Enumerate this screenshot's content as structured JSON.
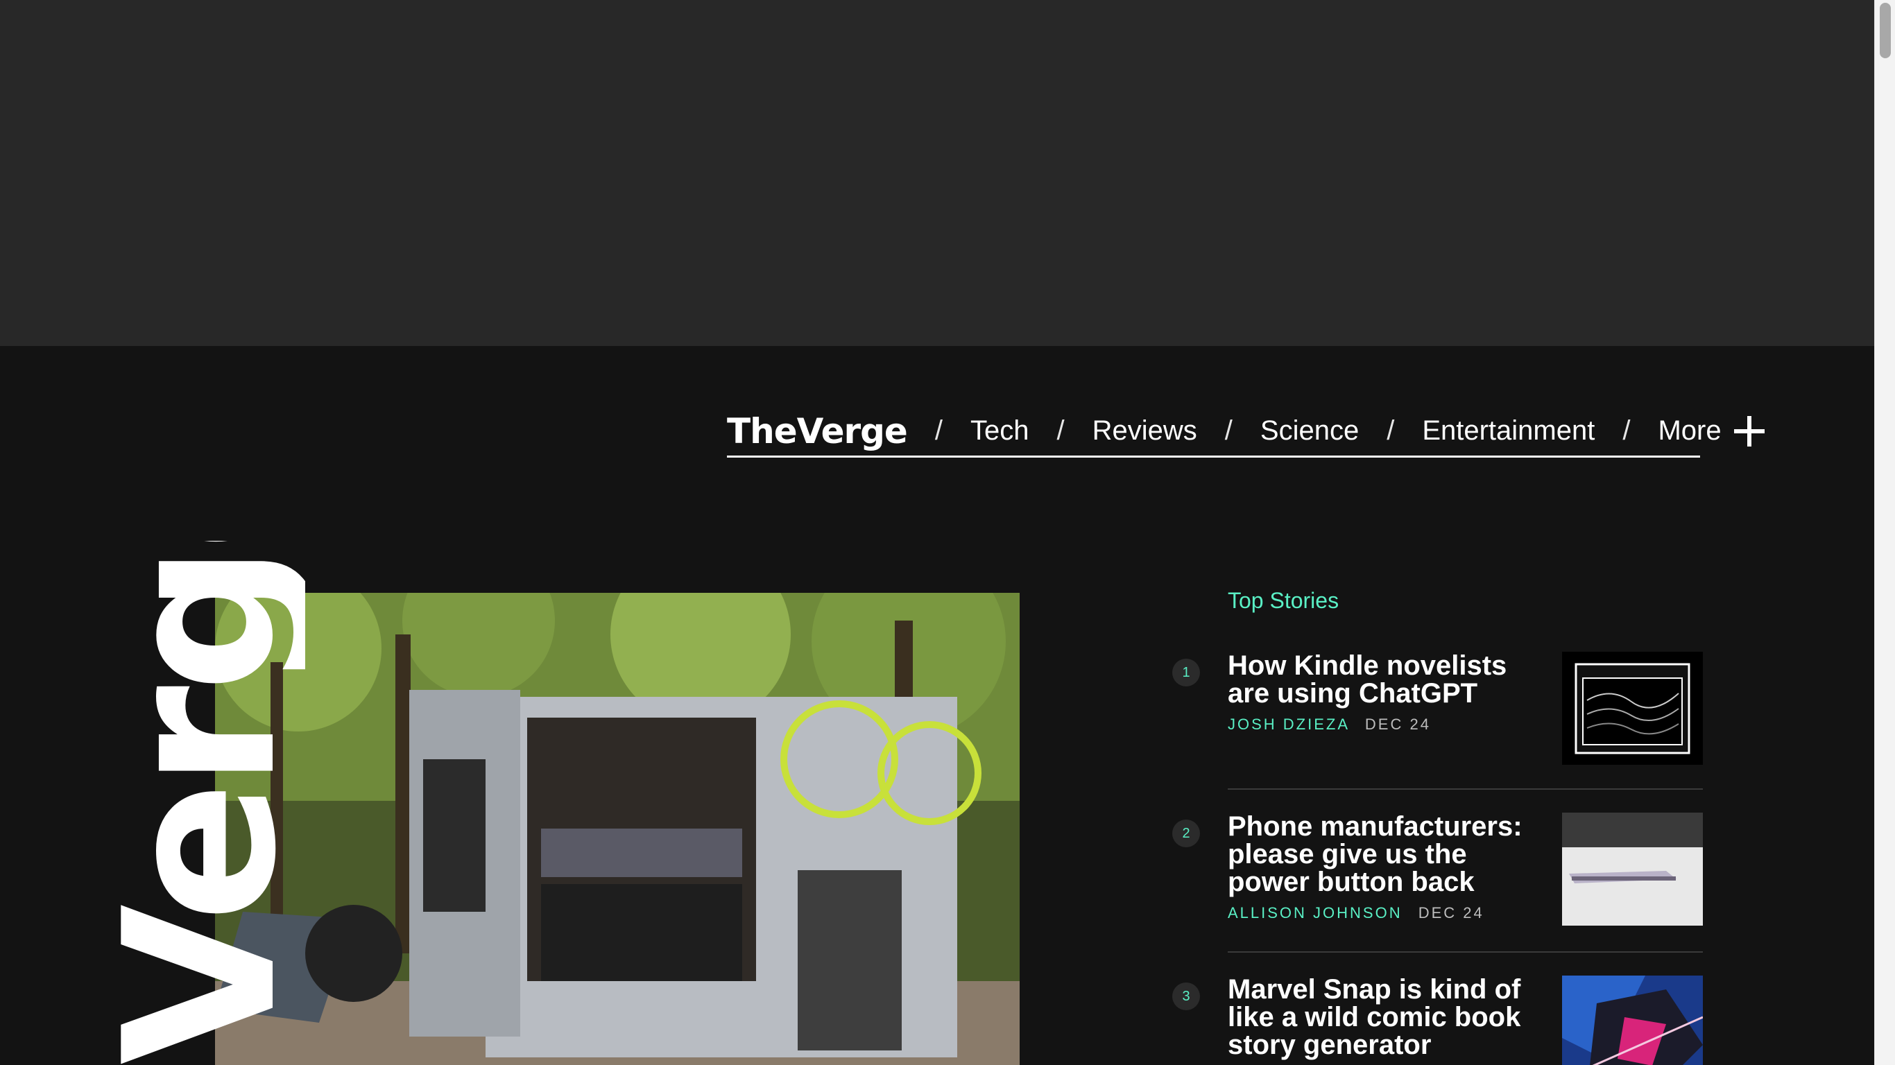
{
  "brand": {
    "logo_text": "TheVerge",
    "accent_color": "#5af0c5"
  },
  "nav": {
    "links": [
      "Tech",
      "Reviews",
      "Science",
      "Entertainment",
      "More"
    ],
    "separator": "/"
  },
  "hero": {
    "side_logo_text": "Verge"
  },
  "top_stories": {
    "label": "Top Stories",
    "items": [
      {
        "rank": "1",
        "headline": "How Kindle novelists are using ChatGPT",
        "author": "JOSH DZIEZA",
        "date": "DEC 24",
        "thumb_icon": "computer-window-illustration"
      },
      {
        "rank": "2",
        "headline": "Phone manufacturers: please give us the power button back",
        "author": "ALLISON JOHNSON",
        "date": "DEC 24",
        "thumb_icon": "phone-on-table-photo"
      },
      {
        "rank": "3",
        "headline": "Marvel Snap is kind of like a wild comic book story generator",
        "author": "",
        "date": "",
        "thumb_icon": "spider-man-artwork"
      }
    ]
  }
}
